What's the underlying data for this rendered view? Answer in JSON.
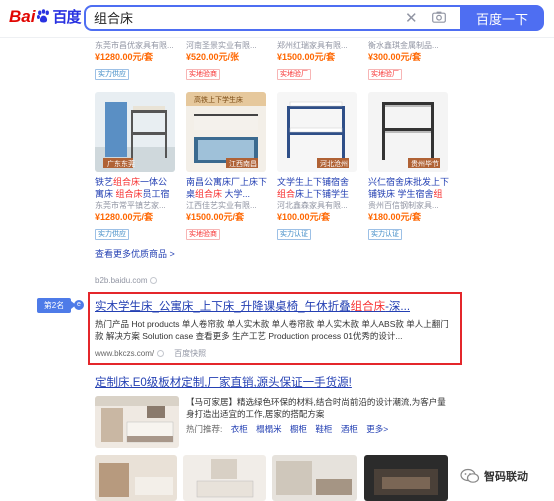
{
  "header": {
    "logo_left": "Bai",
    "logo_right": "百度",
    "search_value": "组合床",
    "search_button": "百度一下"
  },
  "shop": {
    "top_row": [
      {
        "seller": "东莞市昌优家具有限...",
        "price": "¥1280.00元/套",
        "tag": "实力供应"
      },
      {
        "seller": "河南圣景实业有限...",
        "price": "¥520.00元/张",
        "tag": "实地验商"
      },
      {
        "seller": "郑州红瑞家具有限...",
        "price": "¥1500.00元/套",
        "tag": "实地验厂"
      },
      {
        "seller": "衡水鑫琪金属制品...",
        "price": "¥300.00元/套",
        "tag": "实地验厂"
      }
    ],
    "products": [
      {
        "title_pre": "铁艺",
        "title_em": "组合床",
        "title_post": "一体公寓床 ",
        "title_em2": "组合床",
        "title_post2": "员工宿舍",
        "image_label": "广东东莞",
        "seller": "东莞市常平镇艺家...",
        "price": "¥1280.00元/套",
        "tag": "实力供应"
      },
      {
        "title_pre": "南昌公寓床厂上床下桌",
        "title_em": "组合床",
        "title_post": " 大学...",
        "title_em2": "",
        "title_post2": "",
        "image_label": "江西南昌",
        "image_banner": "高铁上下学生床",
        "seller": "江西佳艺实业有限...",
        "price": "¥1500.00元/套",
        "tag": "实地验商"
      },
      {
        "title_pre": "文学生上下铺宿舍",
        "title_em": "组合",
        "title_post": "床上下铺学生床宿舍...",
        "title_em2": "",
        "title_post2": "",
        "image_label": "河北沧州",
        "seller": "河北鑫森家具有限...",
        "price": "¥100.00元/套",
        "tag": "实力认证"
      },
      {
        "title_pre": "兴仁宿舍床批发上下铺铁床 学生宿舍",
        "title_em": "组合",
        "title_post": "...",
        "title_em2": "",
        "title_post2": "",
        "image_label": "贵州毕节",
        "seller": "贵州百信钢制家具...",
        "price": "¥180.00元/套",
        "tag": "实力认证"
      }
    ],
    "more": "查看更多优质商品 >",
    "source": "b2b.baidu.com"
  },
  "result2": {
    "badge": "第2名",
    "badge_icon": "e",
    "title_pre": "实木学生床_公寓床_上下床_升降课桌椅_午休折叠",
    "title_em": "组合床",
    "title_post": "-深...",
    "desc": "热门产品 Hot products 单人卷帘款 单人实木款 单人卷帘款 单人实木款 单人ABS款 单人上翻门款 解决方案 Solution case 查看更多 生产工艺 Production process 01优秀的设计...",
    "url": "www.bkczs.com/",
    "snapshot": "百度快照"
  },
  "result3": {
    "title": "定制床,E0级板材定制,厂家直销,源头保证一手货源!",
    "desc_pre": "【马可家居】精选绿色环保的材料,结合时尚前沿的设计潮流,为客户量身打造出适宜的工作,居家的搭配方案",
    "hot_label": "热门推荐:",
    "hot_links": [
      "衣柜",
      "榻榻米",
      "橱柜",
      "鞋柜",
      "酒柜",
      "更多>"
    ]
  },
  "watermark": "智码联动",
  "colors": {
    "brand_blue": "#4e6ef2",
    "link_blue": "#2440b3",
    "highlight_red": "#e4262b",
    "em_red": "#f73131",
    "price_orange": "#ff6600"
  }
}
